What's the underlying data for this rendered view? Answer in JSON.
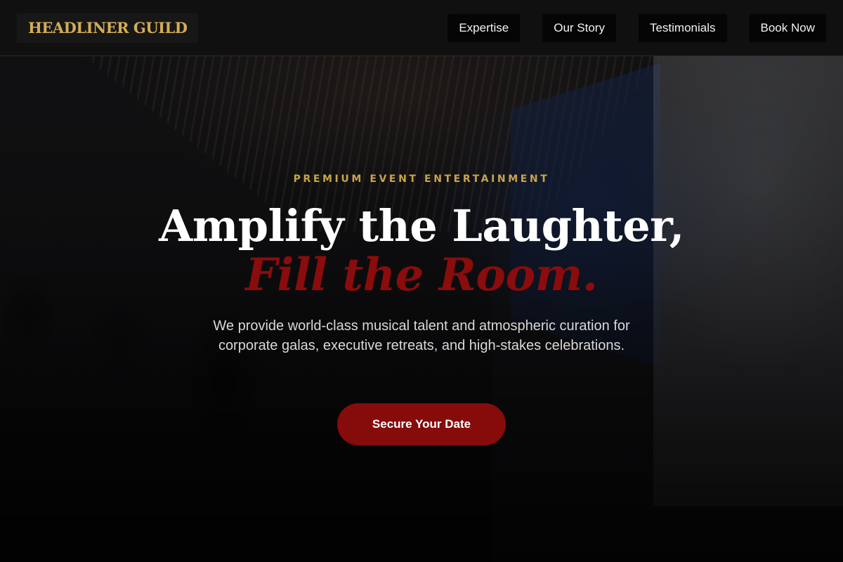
{
  "header": {
    "logo": "HEADLINER GUILD",
    "nav": [
      {
        "label": "Expertise"
      },
      {
        "label": "Our Story"
      },
      {
        "label": "Testimonials"
      },
      {
        "label": "Book Now"
      }
    ]
  },
  "hero": {
    "eyebrow": "PREMIUM EVENT ENTERTAINMENT",
    "headline": "Amplify the Laughter,",
    "headline_accent": "Fill the Room.",
    "subtext": "We provide world-class musical talent and atmospheric curation for corporate galas, executive retreats, and high-stakes celebrations.",
    "cta_label": "Secure Your Date"
  },
  "colors": {
    "gold_accent": "#c9a44a",
    "crimson_accent": "#860b0b",
    "header_bg": "#101011"
  }
}
